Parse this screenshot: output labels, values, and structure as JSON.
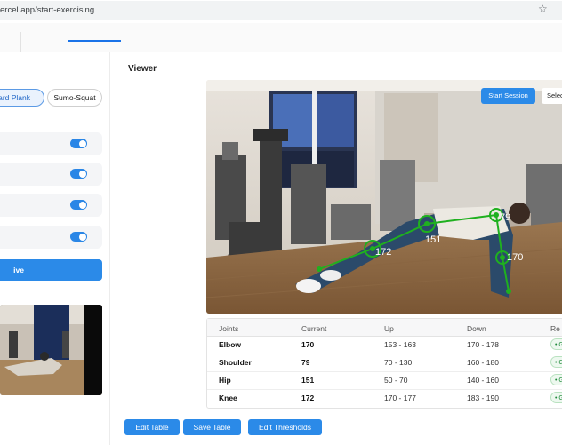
{
  "browser": {
    "url": "ercel.app/start-exercising",
    "star_icon": "star-icon"
  },
  "left_panel": {
    "exercise_chips": [
      {
        "label": "ward Plank",
        "active": true
      },
      {
        "label": "Sumo-Squat",
        "active": false
      }
    ],
    "toggles": [
      {
        "on": true
      },
      {
        "on": true
      },
      {
        "on": true
      },
      {
        "on": true
      }
    ],
    "live_video_button": "ive Video"
  },
  "viewer": {
    "title": "Viewer",
    "start_session_label": "Start Session",
    "select_label": "Selec",
    "angle_labels": {
      "elbow": "79",
      "shoulder": "170",
      "hip": "151",
      "knee": "172"
    }
  },
  "table": {
    "headers": {
      "joints": "Joints",
      "current": "Current",
      "up": "Up",
      "down": "Down",
      "result": "Re"
    },
    "rows": [
      {
        "joint": "Elbow",
        "current": "170",
        "up": "153 - 163",
        "down": "170 - 178",
        "badge": "• G"
      },
      {
        "joint": "Shoulder",
        "current": "79",
        "up": "70 - 130",
        "down": "160 - 180",
        "badge": "• G"
      },
      {
        "joint": "Hip",
        "current": "151",
        "up": "50 - 70",
        "down": "140 - 160",
        "badge": "• G"
      },
      {
        "joint": "Knee",
        "current": "172",
        "up": "170 - 177",
        "down": "183 - 190",
        "badge": "• G"
      }
    ]
  },
  "actions": {
    "edit_table": "Edit Table",
    "save_table": "Save Table",
    "edit_thresholds": "Edit Thresholds"
  },
  "colors": {
    "accent": "#2b8ae8",
    "skeleton": "#1fb01f",
    "success": "#1f8a3a"
  }
}
